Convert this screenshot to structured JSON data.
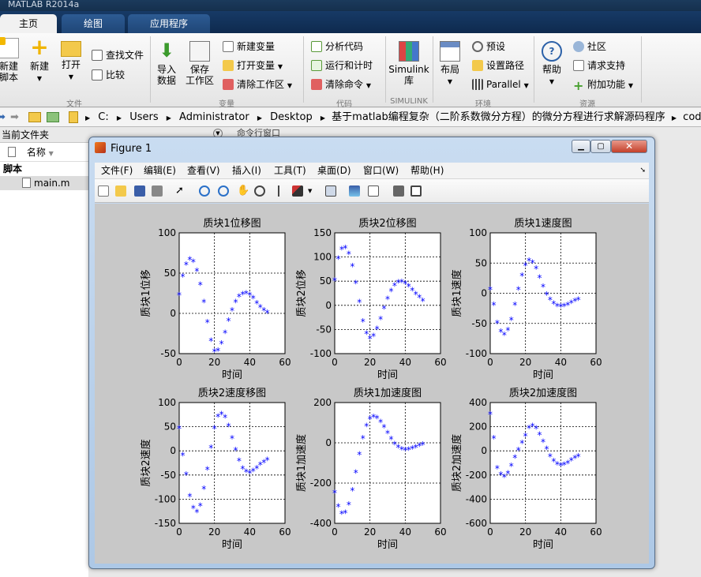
{
  "app": {
    "title": "MATLAB R2014a"
  },
  "ribbon_tabs": [
    {
      "label": "主页",
      "active": true
    },
    {
      "label": "绘图"
    },
    {
      "label": "应用程序"
    }
  ],
  "ribbon": {
    "file": {
      "new_script": "新建\n脚本",
      "new": "新建",
      "open": "打开",
      "find_files": "查找文件",
      "compare": "比较",
      "group": "文件"
    },
    "variable": {
      "import": "导入\n数据",
      "save": "保存\n工作区",
      "new_var": "新建变量",
      "open_var": "打开变量",
      "clear_ws": "清除工作区",
      "group": "变量"
    },
    "code": {
      "analyze": "分析代码",
      "run_time": "运行和计时",
      "clear_cmd": "清除命令",
      "group": "代码"
    },
    "simulink": {
      "lib": "Simulink\n库",
      "group": "SIMULINK"
    },
    "env": {
      "layout": "布局",
      "prefs": "预设",
      "set_path": "设置路径",
      "parallel": "Parallel",
      "group": "环境"
    },
    "resources": {
      "help": "帮助",
      "community": "社区",
      "support": "请求支持",
      "addons": "附加功能",
      "group": "资源"
    }
  },
  "address": {
    "path": [
      "C:",
      "Users",
      "Administrator",
      "Desktop",
      "基于matlab编程复杂（二阶系数微分方程）的微分方程进行求解源码程序",
      "code"
    ]
  },
  "left_panel": {
    "header": "当前文件夹",
    "col_name": "名称",
    "folder": "脚本",
    "file": "main.m"
  },
  "command_header": "命令行窗口",
  "figure": {
    "title": "Figure 1",
    "menu": [
      "文件(F)",
      "编辑(E)",
      "查看(V)",
      "插入(I)",
      "工具(T)",
      "桌面(D)",
      "窗口(W)",
      "帮助(H)"
    ],
    "colors": {
      "marker": "#0000ff",
      "axes_bg": "#ffffff",
      "fig_bg": "#c8c8c8"
    }
  },
  "chart_data": [
    {
      "type": "scatter",
      "title": "质块1位移图",
      "xlabel": "时间",
      "ylabel": "质块1位移",
      "xlim": [
        0,
        60
      ],
      "ylim": [
        -50,
        100
      ],
      "xticks": [
        0,
        20,
        40,
        60
      ],
      "yticks": [
        -50,
        0,
        50,
        100
      ],
      "grid": true,
      "x": [
        0,
        2,
        4,
        6,
        8,
        10,
        12,
        14,
        16,
        18,
        20,
        22,
        24,
        26,
        28,
        30,
        32,
        34,
        36,
        38,
        40,
        42,
        44,
        46,
        48,
        50
      ],
      "y": [
        22,
        45,
        60,
        66,
        63,
        52,
        35,
        13,
        -12,
        -35,
        -48,
        -47,
        -38,
        -25,
        -10,
        3,
        13,
        20,
        23,
        24,
        22,
        18,
        12,
        7,
        3,
        0
      ]
    },
    {
      "type": "scatter",
      "title": "质块2位移图",
      "xlabel": "时间",
      "ylabel": "质块2位移",
      "xlim": [
        0,
        60
      ],
      "ylim": [
        -100,
        150
      ],
      "xticks": [
        0,
        20,
        40,
        60
      ],
      "yticks": [
        -100,
        -50,
        0,
        50,
        100,
        150
      ],
      "grid": true,
      "x": [
        0,
        2,
        4,
        6,
        8,
        10,
        12,
        14,
        16,
        18,
        20,
        22,
        24,
        26,
        28,
        30,
        32,
        34,
        36,
        38,
        40,
        42,
        44,
        46,
        48,
        50
      ],
      "y": [
        50,
        95,
        115,
        117,
        105,
        80,
        45,
        5,
        -35,
        -60,
        -70,
        -65,
        -50,
        -30,
        -8,
        12,
        28,
        40,
        46,
        47,
        44,
        38,
        30,
        22,
        15,
        8
      ]
    },
    {
      "type": "scatter",
      "title": "质块1速度图",
      "xlabel": "时间",
      "ylabel": "质块1速度",
      "xlim": [
        0,
        60
      ],
      "ylim": [
        -100,
        100
      ],
      "xticks": [
        0,
        20,
        40,
        60
      ],
      "yticks": [
        -100,
        -50,
        0,
        50,
        100
      ],
      "grid": true,
      "x": [
        0,
        2,
        4,
        6,
        8,
        10,
        12,
        14,
        16,
        18,
        20,
        22,
        24,
        26,
        28,
        30,
        32,
        34,
        36,
        38,
        40,
        42,
        44,
        46,
        48,
        50
      ],
      "y": [
        5,
        -20,
        -50,
        -65,
        -70,
        -62,
        -45,
        -20,
        5,
        28,
        45,
        53,
        50,
        40,
        25,
        10,
        -3,
        -12,
        -18,
        -22,
        -23,
        -22,
        -20,
        -17,
        -14,
        -12
      ]
    },
    {
      "type": "scatter",
      "title": "质块2速度移图",
      "xlabel": "时间",
      "ylabel": "质块2速度",
      "xlim": [
        0,
        60
      ],
      "ylim": [
        -150,
        100
      ],
      "xticks": [
        0,
        20,
        40,
        60
      ],
      "yticks": [
        -150,
        -100,
        -50,
        0,
        50,
        100
      ],
      "grid": true,
      "x": [
        0,
        2,
        4,
        6,
        8,
        10,
        12,
        14,
        16,
        18,
        20,
        22,
        24,
        26,
        28,
        30,
        32,
        34,
        36,
        38,
        40,
        42,
        44,
        46,
        48,
        50
      ],
      "y": [
        45,
        -10,
        -50,
        -95,
        -120,
        -128,
        -115,
        -80,
        -40,
        5,
        45,
        70,
        75,
        68,
        50,
        25,
        0,
        -22,
        -38,
        -45,
        -47,
        -43,
        -37,
        -30,
        -25,
        -20
      ]
    },
    {
      "type": "scatter",
      "title": "质块1加速度图",
      "xlabel": "时间",
      "ylabel": "质块1加速度",
      "xlim": [
        0,
        60
      ],
      "ylim": [
        -400,
        200
      ],
      "xticks": [
        0,
        20,
        40,
        60
      ],
      "yticks": [
        -400,
        -200,
        0,
        200
      ],
      "grid": true,
      "x": [
        0,
        2,
        4,
        6,
        8,
        10,
        12,
        14,
        16,
        18,
        20,
        22,
        24,
        26,
        28,
        30,
        32,
        34,
        36,
        38,
        40,
        42,
        44,
        46,
        48,
        50
      ],
      "y": [
        -250,
        -320,
        -355,
        -350,
        -310,
        -240,
        -150,
        -60,
        20,
        80,
        115,
        125,
        120,
        100,
        75,
        45,
        15,
        -10,
        -25,
        -35,
        -40,
        -38,
        -32,
        -25,
        -18,
        -12
      ]
    },
    {
      "type": "scatter",
      "title": "质块2加速度图",
      "xlabel": "时间",
      "ylabel": "质块2加速度",
      "xlim": [
        0,
        60
      ],
      "ylim": [
        -600,
        400
      ],
      "xticks": [
        0,
        20,
        40,
        60
      ],
      "yticks": [
        -600,
        -400,
        -200,
        0,
        200,
        400
      ],
      "grid": true,
      "x": [
        0,
        2,
        4,
        6,
        8,
        10,
        12,
        14,
        16,
        18,
        20,
        22,
        24,
        26,
        28,
        30,
        32,
        34,
        36,
        38,
        40,
        42,
        44,
        46,
        48,
        50
      ],
      "y": [
        300,
        100,
        -150,
        -200,
        -220,
        -190,
        -130,
        -60,
        0,
        60,
        120,
        185,
        200,
        180,
        130,
        70,
        10,
        -50,
        -90,
        -115,
        -125,
        -120,
        -105,
        -85,
        -65,
        -50
      ]
    }
  ]
}
